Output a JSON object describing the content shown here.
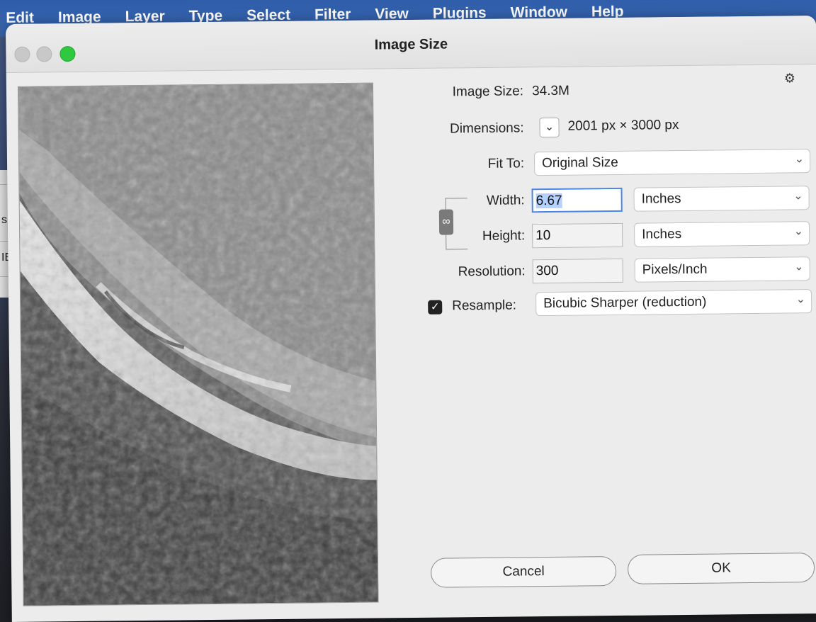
{
  "menubar": {
    "items": [
      "Edit",
      "Image",
      "Layer",
      "Type",
      "Select",
      "Filter",
      "View",
      "Plugins",
      "Window",
      "Help"
    ]
  },
  "background_app": {
    "fragment_1": "s",
    "fragment_2": "IE"
  },
  "dialog": {
    "title": "Image Size",
    "image_size_label": "Image Size:",
    "image_size_value": "34.3M",
    "dimensions_label": "Dimensions:",
    "dimensions_value": "2001 px  ×  3000 px",
    "fit_to_label": "Fit To:",
    "fit_to_value": "Original Size",
    "width_label": "Width:",
    "width_value": "6.67",
    "width_unit": "Inches",
    "height_label": "Height:",
    "height_value": "10",
    "height_unit": "Inches",
    "resolution_label": "Resolution:",
    "resolution_value": "300",
    "resolution_unit": "Pixels/Inch",
    "resample_label": "Resample:",
    "resample_checked": true,
    "resample_value": "Bicubic Sharper (reduction)",
    "cancel_label": "Cancel",
    "ok_label": "OK"
  },
  "icons": {
    "chevron": "⌄",
    "gear": "⚙",
    "link": "∞",
    "check": "✓"
  }
}
